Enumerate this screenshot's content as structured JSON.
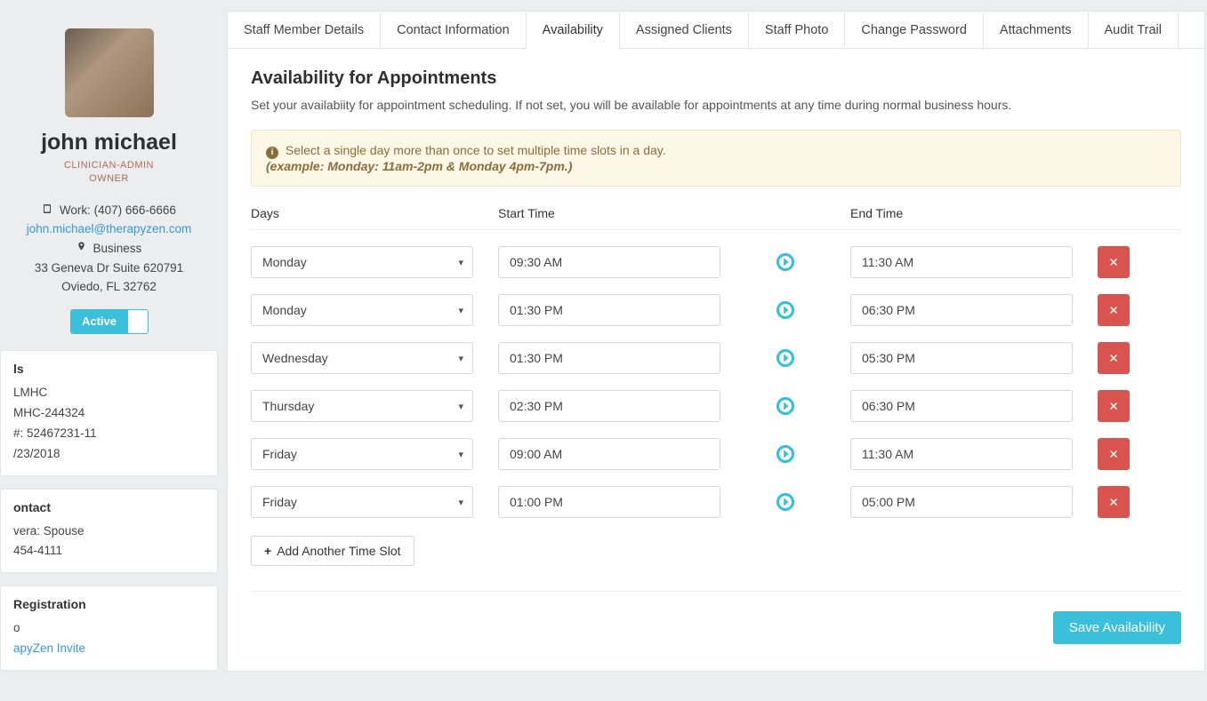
{
  "profile": {
    "name": "john michael",
    "role_line1": "CLINICIAN-ADMIN",
    "role_line2": "OWNER",
    "phone_label": "Work:",
    "phone": "(407) 666-6666",
    "email": "john.michael@therapyzen.com",
    "address_label": "Business",
    "address_line1": "33 Geneva Dr Suite 620791",
    "address_line2": "Oviedo, FL 32762",
    "status_label": "Active"
  },
  "credentials": {
    "heading": "ls",
    "lines": [
      "LMHC",
      "MHC-244324",
      "#: 52467231-11",
      "/23/2018"
    ]
  },
  "emergency": {
    "heading": "ontact",
    "lines": [
      "vera: Spouse",
      "454-4111"
    ]
  },
  "registration": {
    "heading": "Registration",
    "lines": [
      "o",
      "apyZen Invite"
    ]
  },
  "tabs": [
    "Staff Member Details",
    "Contact Information",
    "Availability",
    "Assigned Clients",
    "Staff Photo",
    "Change Password",
    "Attachments",
    "Audit Trail"
  ],
  "active_tab_index": 2,
  "availability": {
    "title": "Availability for Appointments",
    "subtext": "Set your availabiity for appointment scheduling. If not set, you will be available for appointments at any time during normal business hours.",
    "info_text": "Select a single day more than once to set multiple time slots in a day.",
    "info_example": "(example: Monday: 11am-2pm & Monday 4pm-7pm.)",
    "col_days": "Days",
    "col_start": "Start Time",
    "col_end": "End Time",
    "slots": [
      {
        "day": "Monday",
        "start": "09:30 AM",
        "end": "11:30 AM"
      },
      {
        "day": "Monday",
        "start": "01:30 PM",
        "end": "06:30 PM"
      },
      {
        "day": "Wednesday",
        "start": "01:30 PM",
        "end": "05:30 PM"
      },
      {
        "day": "Thursday",
        "start": "02:30 PM",
        "end": "06:30 PM"
      },
      {
        "day": "Friday",
        "start": "09:00 AM",
        "end": "11:30 AM"
      },
      {
        "day": "Friday",
        "start": "01:00 PM",
        "end": "05:00 PM"
      }
    ],
    "add_label": "Add Another Time Slot",
    "save_label": "Save Availability"
  }
}
